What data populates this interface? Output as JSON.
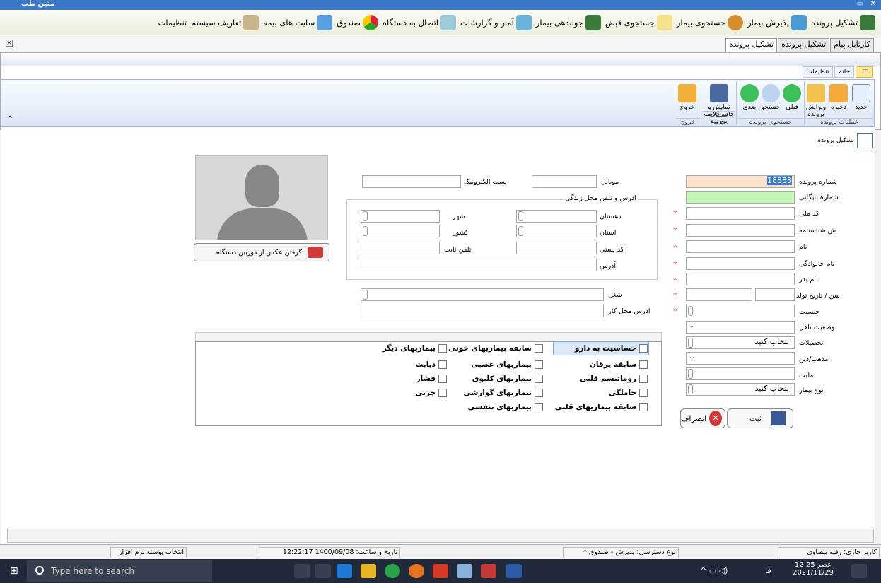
{
  "window_title": "متین طب",
  "menu": [
    "تشکیل پرونده",
    "پذیرش بیمار",
    "جستجوی بیمار",
    "جستجوی قبض",
    "جوابدهی بیمار",
    "آمار و گزارشات",
    "اتصال به دستگاه",
    "صندوق",
    "سایت های بیمه",
    "تعاریف سیستم",
    "تنظیمات"
  ],
  "tabs": [
    "کارتابل پیام",
    "تشکیل پرونده",
    "تشکیل پرونده"
  ],
  "ribbon_tabs": [
    "خانه",
    "تنظیمات"
  ],
  "ribbon": {
    "btns": [
      "جدید",
      "ذخیره",
      "ویرایش پرونده",
      "قبلی",
      "جستجو",
      "بعدی",
      "نمایش و چاپ خلاصه پرونده",
      "خروج"
    ],
    "groups": [
      "عملیات پرونده",
      "جستجوی پرونده",
      "عملیات چاپ",
      "خروج"
    ]
  },
  "page_title": "تشکیل پرونده",
  "form": {
    "file_no_label": "شماره پرونده",
    "file_no": "18888",
    "archive_label": "شماره بایگانی",
    "national_label": "کد ملی",
    "idno_label": "ش.شناسنامه",
    "name_label": "نام",
    "family_label": "نام خانوادگی",
    "father_label": "نام پدر",
    "age_label": "سن / تاریخ تولد",
    "gender_label": "جنسیت",
    "marital_label": "وضعیت تاهل",
    "edu_label": "تحصیلات",
    "edu_value": "انتخاب کنید",
    "religion_label": "مذهب/دین",
    "nation_label": "ملیت",
    "ptype_label": "نوع بیمار",
    "ptype_value": "انتخاب کنید",
    "mobile_label": "موبایل",
    "email_label": "پست الکترونیک",
    "addr_group": "آدرس  و تلفن محل زندگی",
    "village_label": "دهستان",
    "city_label": "شهر",
    "province_label": "استان",
    "country_label": "کشور",
    "postal_label": "کد پستی",
    "phone_label": "تلفن ثابت",
    "address_label": "آدرس",
    "job_label": "شغل",
    "workaddr_label": "آدرس محل کار",
    "camera_btn": "گرفتن عکس  از دوربین دستگاه",
    "save_btn": "ثبت",
    "cancel_btn": "انصراف"
  },
  "checkboxes": [
    [
      "حساسیت به دارو",
      "سابقه بیماریهای خونی",
      "بیماریهای دیگر"
    ],
    [
      "سابقه یرقان",
      "بیماریهای عصبی",
      "دیابت"
    ],
    [
      "روماتیسم قلبی",
      "بیماریهای کلیوی",
      "فشار"
    ],
    [
      "حاملگی",
      "بیماریهای گوارشی",
      "چربی"
    ],
    [
      "سابقه بیماریهای قلبی",
      "بیماریهای تنفسی",
      ""
    ]
  ],
  "status": {
    "user": "کاربر جاری: رقیه بیضاوی",
    "access": "نوع دسترسی: پذیرش - صندوق *",
    "datetime": "تاریخ و ساعت:  1400/09/08   12:22:17",
    "version": "انتخاب بوسته نرم افزار"
  },
  "taskbar": {
    "search": "Type here to search",
    "time": "12:25",
    "ampm": "عصر",
    "date": "2021/11/29",
    "lang": "فا"
  }
}
